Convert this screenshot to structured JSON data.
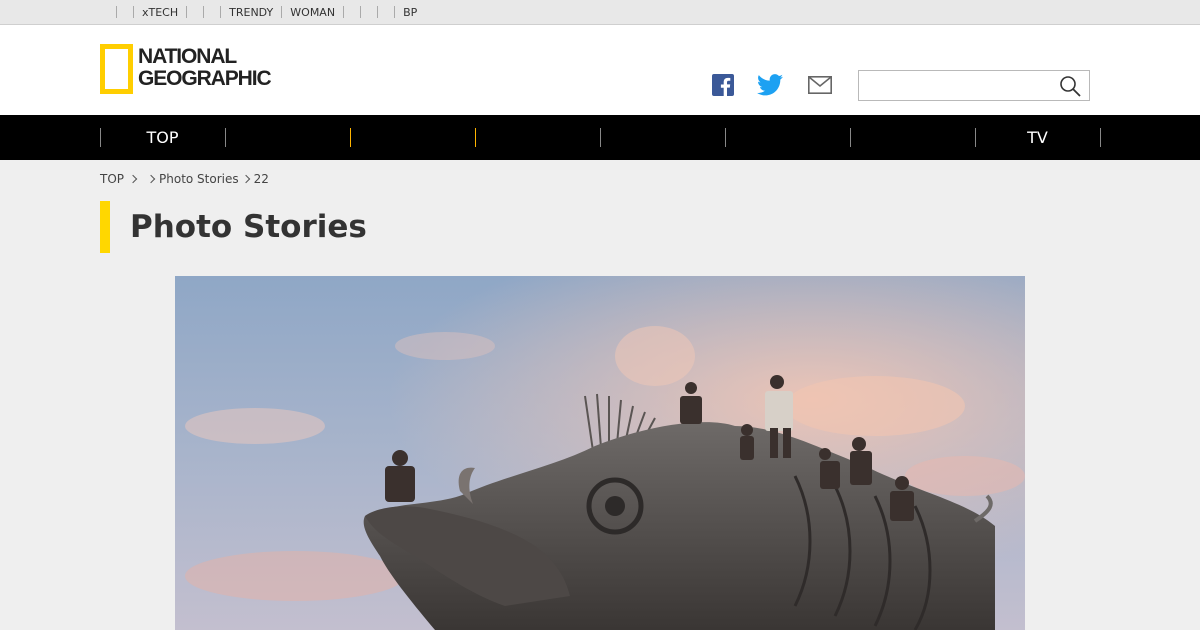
{
  "utility_bar": {
    "items": [
      {
        "label": ""
      },
      {
        "label": "xTECH"
      },
      {
        "label": ""
      },
      {
        "label": ""
      },
      {
        "label": "TRENDY"
      },
      {
        "label": "WOMAN"
      },
      {
        "label": ""
      },
      {
        "label": ""
      },
      {
        "label": ""
      },
      {
        "label": "BP"
      }
    ]
  },
  "header": {
    "logo_line1": "NATIONAL",
    "logo_line2": "GEOGRAPHIC",
    "social": [
      "facebook-icon",
      "twitter-icon",
      "mail-icon"
    ],
    "search": {
      "placeholder": "",
      "value": ""
    }
  },
  "nav": {
    "items": [
      {
        "label": "TOP"
      },
      {
        "label": ""
      },
      {
        "label": ""
      },
      {
        "label": ""
      },
      {
        "label": ""
      },
      {
        "label": ""
      },
      {
        "label": ""
      },
      {
        "label": "TV"
      }
    ]
  },
  "breadcrumb": {
    "items": [
      "TOP",
      "",
      "Photo Stories",
      "22"
    ]
  },
  "page": {
    "title": "Photo Stories"
  },
  "colors": {
    "accent_yellow": "#ffd700",
    "nav_bg": "#000000",
    "facebook": "#3b5998",
    "twitter": "#1da1f2"
  }
}
